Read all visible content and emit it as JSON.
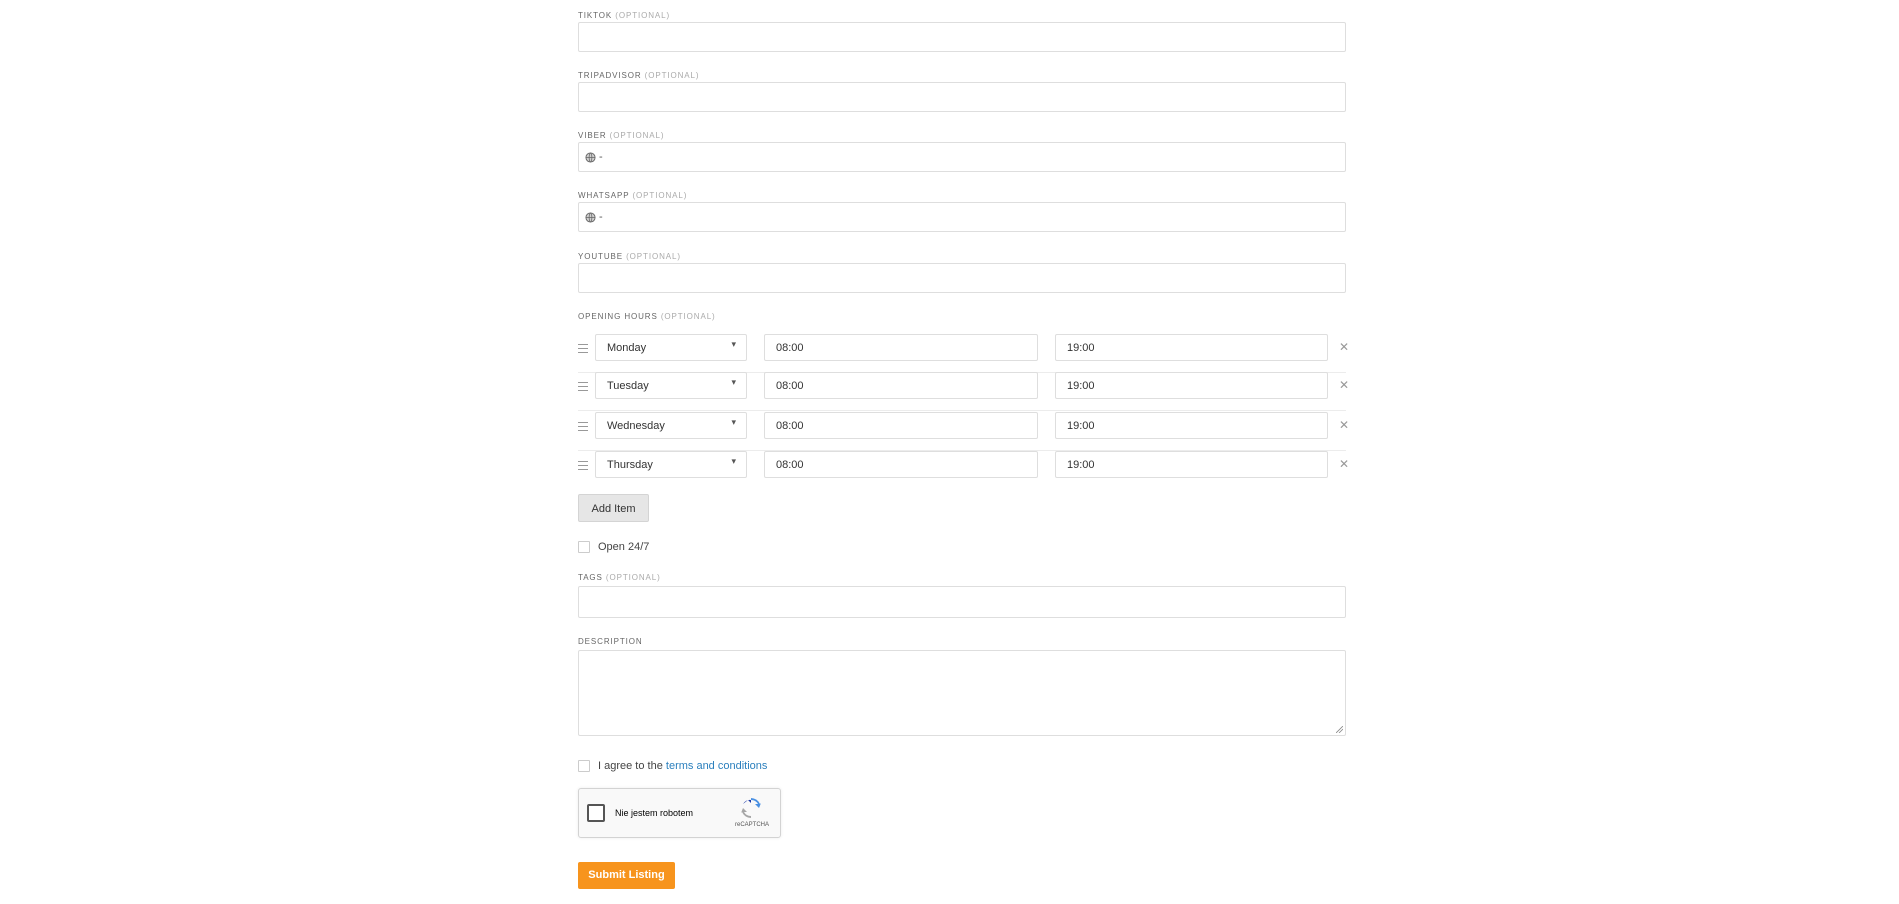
{
  "fields": {
    "tiktok": {
      "label": "TIKTOK",
      "optional": "(OPTIONAL)",
      "value": ""
    },
    "tripadvisor": {
      "label": "TRIPADVISOR",
      "optional": "(OPTIONAL)",
      "value": ""
    },
    "viber": {
      "label": "VIBER",
      "optional": "(OPTIONAL)",
      "prefix": "-"
    },
    "whatsapp": {
      "label": "WHATSAPP",
      "optional": "(OPTIONAL)",
      "prefix": "-"
    },
    "youtube": {
      "label": "YOUTUBE",
      "optional": "(OPTIONAL)",
      "value": ""
    },
    "opening_hours": {
      "label": "OPENING HOURS",
      "optional": "(OPTIONAL)"
    },
    "tags": {
      "label": "TAGS",
      "optional": "(OPTIONAL)",
      "value": ""
    },
    "description": {
      "label": "DESCRIPTION",
      "value": ""
    }
  },
  "hours": [
    {
      "day": "Monday",
      "open": "08:00",
      "close": "19:00"
    },
    {
      "day": "Tuesday",
      "open": "08:00",
      "close": "19:00"
    },
    {
      "day": "Wednesday",
      "open": "08:00",
      "close": "19:00"
    },
    {
      "day": "Thursday",
      "open": "08:00",
      "close": "19:00"
    }
  ],
  "add_item_label": "Add Item",
  "open247_label": "Open 24/7",
  "agree": {
    "text": "I agree to the",
    "link": "terms and conditions"
  },
  "captcha": {
    "text": "Nie jestem robotem",
    "brand": "reCAPTCHA"
  },
  "submit_label": "Submit Listing",
  "icons": {
    "drag": "drag-handle-icon",
    "remove": "close-icon",
    "caret": "caret-down-icon",
    "globe": "globe-icon"
  },
  "colors": {
    "accent": "#f7941d",
    "link": "#2a7fbd",
    "border": "#dedede"
  }
}
